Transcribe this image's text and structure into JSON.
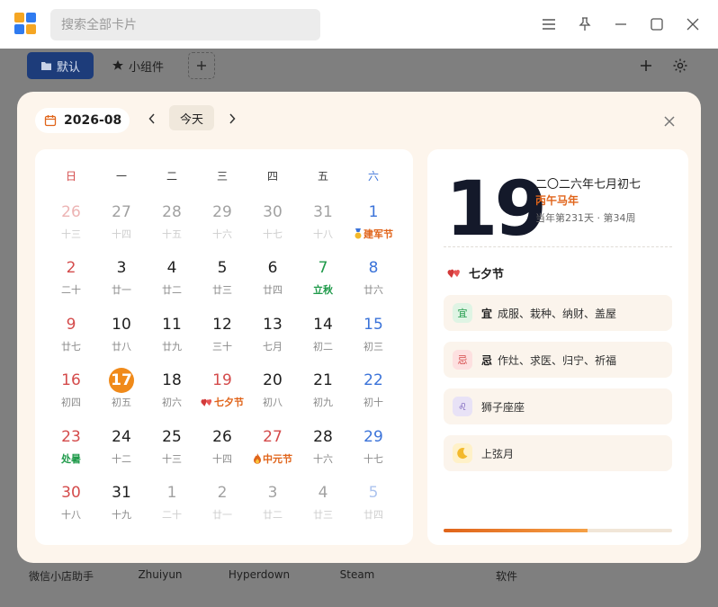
{
  "titlebar": {
    "search_placeholder": "搜索全部卡片"
  },
  "tabs": {
    "default_label": "默认",
    "widget_label": "小组件"
  },
  "apps": [
    "微信小店助手",
    "Zhuiyun",
    "Hyperdown",
    "Steam",
    "软件"
  ],
  "calendar": {
    "month": "2026-08",
    "today_label": "今天",
    "weekdays": [
      "日",
      "一",
      "二",
      "三",
      "四",
      "五",
      "六"
    ],
    "days": [
      {
        "n": "26",
        "s": "十三",
        "cls": "red dim"
      },
      {
        "n": "27",
        "s": "十四",
        "cls": "dim"
      },
      {
        "n": "28",
        "s": "十五",
        "cls": "dim"
      },
      {
        "n": "29",
        "s": "十六",
        "cls": "dim"
      },
      {
        "n": "30",
        "s": "十七",
        "cls": "dim"
      },
      {
        "n": "31",
        "s": "十八",
        "cls": "dim"
      },
      {
        "n": "1",
        "s": "建军节",
        "cls": "blue",
        "scls": "orange",
        "ico": "medal"
      },
      {
        "n": "2",
        "s": "二十",
        "cls": "red"
      },
      {
        "n": "3",
        "s": "廿一",
        "cls": ""
      },
      {
        "n": "4",
        "s": "廿二",
        "cls": ""
      },
      {
        "n": "5",
        "s": "廿三",
        "cls": ""
      },
      {
        "n": "6",
        "s": "廿四",
        "cls": ""
      },
      {
        "n": "7",
        "s": "立秋",
        "cls": "green",
        "scls": "green"
      },
      {
        "n": "8",
        "s": "廿六",
        "cls": "blue"
      },
      {
        "n": "9",
        "s": "廿七",
        "cls": "red"
      },
      {
        "n": "10",
        "s": "廿八",
        "cls": ""
      },
      {
        "n": "11",
        "s": "廿九",
        "cls": ""
      },
      {
        "n": "12",
        "s": "三十",
        "cls": ""
      },
      {
        "n": "13",
        "s": "七月",
        "cls": ""
      },
      {
        "n": "14",
        "s": "初二",
        "cls": ""
      },
      {
        "n": "15",
        "s": "初三",
        "cls": "blue"
      },
      {
        "n": "16",
        "s": "初四",
        "cls": "red"
      },
      {
        "n": "17",
        "s": "初五",
        "cls": "today"
      },
      {
        "n": "18",
        "s": "初六",
        "cls": ""
      },
      {
        "n": "19",
        "s": "七夕节",
        "cls": "red",
        "scls": "orange",
        "ico": "heart"
      },
      {
        "n": "20",
        "s": "初八",
        "cls": ""
      },
      {
        "n": "21",
        "s": "初九",
        "cls": ""
      },
      {
        "n": "22",
        "s": "初十",
        "cls": "blue"
      },
      {
        "n": "23",
        "s": "处暑",
        "cls": "red",
        "scls": "green"
      },
      {
        "n": "24",
        "s": "十二",
        "cls": ""
      },
      {
        "n": "25",
        "s": "十三",
        "cls": ""
      },
      {
        "n": "26",
        "s": "十四",
        "cls": ""
      },
      {
        "n": "27",
        "s": "中元节",
        "cls": "red",
        "scls": "orange",
        "ico": "fire"
      },
      {
        "n": "28",
        "s": "十六",
        "cls": ""
      },
      {
        "n": "29",
        "s": "十七",
        "cls": "blue"
      },
      {
        "n": "30",
        "s": "十八",
        "cls": "red"
      },
      {
        "n": "31",
        "s": "十九",
        "cls": ""
      },
      {
        "n": "1",
        "s": "二十",
        "cls": "dim"
      },
      {
        "n": "2",
        "s": "廿一",
        "cls": "dim"
      },
      {
        "n": "3",
        "s": "廿二",
        "cls": "dim"
      },
      {
        "n": "4",
        "s": "廿三",
        "cls": "dim"
      },
      {
        "n": "5",
        "s": "廿四",
        "cls": "blue dim"
      }
    ]
  },
  "detail": {
    "big_day": "19",
    "lunar_date": "二〇二六年七月初七",
    "ganzhi": "丙午马年",
    "day_of_year": "当年第231天 · 第34周",
    "festival": "七夕节",
    "yi_badge": "宜",
    "yi_label": "宜",
    "yi_text": "成服、栽种、纳财、盖屋",
    "ji_badge": "忌",
    "ji_label": "忌",
    "ji_text": "作灶、求医、归宁、祈福",
    "zodiac_badge": "♌",
    "zodiac_text": "狮子座座",
    "moon_text": "上弦月",
    "year_progress": 0.63,
    "colors": {
      "accent": "#e0641a",
      "today": "#f08a1a",
      "weekend_sun": "#d44b4b",
      "weekend_sat": "#3b73d9"
    }
  }
}
